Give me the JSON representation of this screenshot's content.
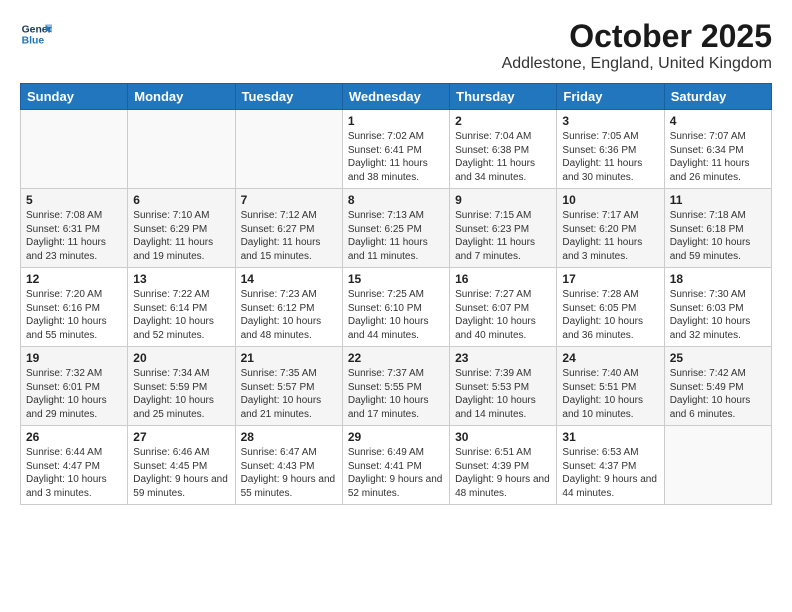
{
  "header": {
    "logo_line1": "General",
    "logo_line2": "Blue",
    "month": "October 2025",
    "location": "Addlestone, England, United Kingdom"
  },
  "weekdays": [
    "Sunday",
    "Monday",
    "Tuesday",
    "Wednesday",
    "Thursday",
    "Friday",
    "Saturday"
  ],
  "weeks": [
    [
      {
        "day": "",
        "sunrise": "",
        "sunset": "",
        "daylight": ""
      },
      {
        "day": "",
        "sunrise": "",
        "sunset": "",
        "daylight": ""
      },
      {
        "day": "",
        "sunrise": "",
        "sunset": "",
        "daylight": ""
      },
      {
        "day": "1",
        "sunrise": "Sunrise: 7:02 AM",
        "sunset": "Sunset: 6:41 PM",
        "daylight": "Daylight: 11 hours and 38 minutes."
      },
      {
        "day": "2",
        "sunrise": "Sunrise: 7:04 AM",
        "sunset": "Sunset: 6:38 PM",
        "daylight": "Daylight: 11 hours and 34 minutes."
      },
      {
        "day": "3",
        "sunrise": "Sunrise: 7:05 AM",
        "sunset": "Sunset: 6:36 PM",
        "daylight": "Daylight: 11 hours and 30 minutes."
      },
      {
        "day": "4",
        "sunrise": "Sunrise: 7:07 AM",
        "sunset": "Sunset: 6:34 PM",
        "daylight": "Daylight: 11 hours and 26 minutes."
      }
    ],
    [
      {
        "day": "5",
        "sunrise": "Sunrise: 7:08 AM",
        "sunset": "Sunset: 6:31 PM",
        "daylight": "Daylight: 11 hours and 23 minutes."
      },
      {
        "day": "6",
        "sunrise": "Sunrise: 7:10 AM",
        "sunset": "Sunset: 6:29 PM",
        "daylight": "Daylight: 11 hours and 19 minutes."
      },
      {
        "day": "7",
        "sunrise": "Sunrise: 7:12 AM",
        "sunset": "Sunset: 6:27 PM",
        "daylight": "Daylight: 11 hours and 15 minutes."
      },
      {
        "day": "8",
        "sunrise": "Sunrise: 7:13 AM",
        "sunset": "Sunset: 6:25 PM",
        "daylight": "Daylight: 11 hours and 11 minutes."
      },
      {
        "day": "9",
        "sunrise": "Sunrise: 7:15 AM",
        "sunset": "Sunset: 6:23 PM",
        "daylight": "Daylight: 11 hours and 7 minutes."
      },
      {
        "day": "10",
        "sunrise": "Sunrise: 7:17 AM",
        "sunset": "Sunset: 6:20 PM",
        "daylight": "Daylight: 11 hours and 3 minutes."
      },
      {
        "day": "11",
        "sunrise": "Sunrise: 7:18 AM",
        "sunset": "Sunset: 6:18 PM",
        "daylight": "Daylight: 10 hours and 59 minutes."
      }
    ],
    [
      {
        "day": "12",
        "sunrise": "Sunrise: 7:20 AM",
        "sunset": "Sunset: 6:16 PM",
        "daylight": "Daylight: 10 hours and 55 minutes."
      },
      {
        "day": "13",
        "sunrise": "Sunrise: 7:22 AM",
        "sunset": "Sunset: 6:14 PM",
        "daylight": "Daylight: 10 hours and 52 minutes."
      },
      {
        "day": "14",
        "sunrise": "Sunrise: 7:23 AM",
        "sunset": "Sunset: 6:12 PM",
        "daylight": "Daylight: 10 hours and 48 minutes."
      },
      {
        "day": "15",
        "sunrise": "Sunrise: 7:25 AM",
        "sunset": "Sunset: 6:10 PM",
        "daylight": "Daylight: 10 hours and 44 minutes."
      },
      {
        "day": "16",
        "sunrise": "Sunrise: 7:27 AM",
        "sunset": "Sunset: 6:07 PM",
        "daylight": "Daylight: 10 hours and 40 minutes."
      },
      {
        "day": "17",
        "sunrise": "Sunrise: 7:28 AM",
        "sunset": "Sunset: 6:05 PM",
        "daylight": "Daylight: 10 hours and 36 minutes."
      },
      {
        "day": "18",
        "sunrise": "Sunrise: 7:30 AM",
        "sunset": "Sunset: 6:03 PM",
        "daylight": "Daylight: 10 hours and 32 minutes."
      }
    ],
    [
      {
        "day": "19",
        "sunrise": "Sunrise: 7:32 AM",
        "sunset": "Sunset: 6:01 PM",
        "daylight": "Daylight: 10 hours and 29 minutes."
      },
      {
        "day": "20",
        "sunrise": "Sunrise: 7:34 AM",
        "sunset": "Sunset: 5:59 PM",
        "daylight": "Daylight: 10 hours and 25 minutes."
      },
      {
        "day": "21",
        "sunrise": "Sunrise: 7:35 AM",
        "sunset": "Sunset: 5:57 PM",
        "daylight": "Daylight: 10 hours and 21 minutes."
      },
      {
        "day": "22",
        "sunrise": "Sunrise: 7:37 AM",
        "sunset": "Sunset: 5:55 PM",
        "daylight": "Daylight: 10 hours and 17 minutes."
      },
      {
        "day": "23",
        "sunrise": "Sunrise: 7:39 AM",
        "sunset": "Sunset: 5:53 PM",
        "daylight": "Daylight: 10 hours and 14 minutes."
      },
      {
        "day": "24",
        "sunrise": "Sunrise: 7:40 AM",
        "sunset": "Sunset: 5:51 PM",
        "daylight": "Daylight: 10 hours and 10 minutes."
      },
      {
        "day": "25",
        "sunrise": "Sunrise: 7:42 AM",
        "sunset": "Sunset: 5:49 PM",
        "daylight": "Daylight: 10 hours and 6 minutes."
      }
    ],
    [
      {
        "day": "26",
        "sunrise": "Sunrise: 6:44 AM",
        "sunset": "Sunset: 4:47 PM",
        "daylight": "Daylight: 10 hours and 3 minutes."
      },
      {
        "day": "27",
        "sunrise": "Sunrise: 6:46 AM",
        "sunset": "Sunset: 4:45 PM",
        "daylight": "Daylight: 9 hours and 59 minutes."
      },
      {
        "day": "28",
        "sunrise": "Sunrise: 6:47 AM",
        "sunset": "Sunset: 4:43 PM",
        "daylight": "Daylight: 9 hours and 55 minutes."
      },
      {
        "day": "29",
        "sunrise": "Sunrise: 6:49 AM",
        "sunset": "Sunset: 4:41 PM",
        "daylight": "Daylight: 9 hours and 52 minutes."
      },
      {
        "day": "30",
        "sunrise": "Sunrise: 6:51 AM",
        "sunset": "Sunset: 4:39 PM",
        "daylight": "Daylight: 9 hours and 48 minutes."
      },
      {
        "day": "31",
        "sunrise": "Sunrise: 6:53 AM",
        "sunset": "Sunset: 4:37 PM",
        "daylight": "Daylight: 9 hours and 44 minutes."
      },
      {
        "day": "",
        "sunrise": "",
        "sunset": "",
        "daylight": ""
      }
    ]
  ]
}
